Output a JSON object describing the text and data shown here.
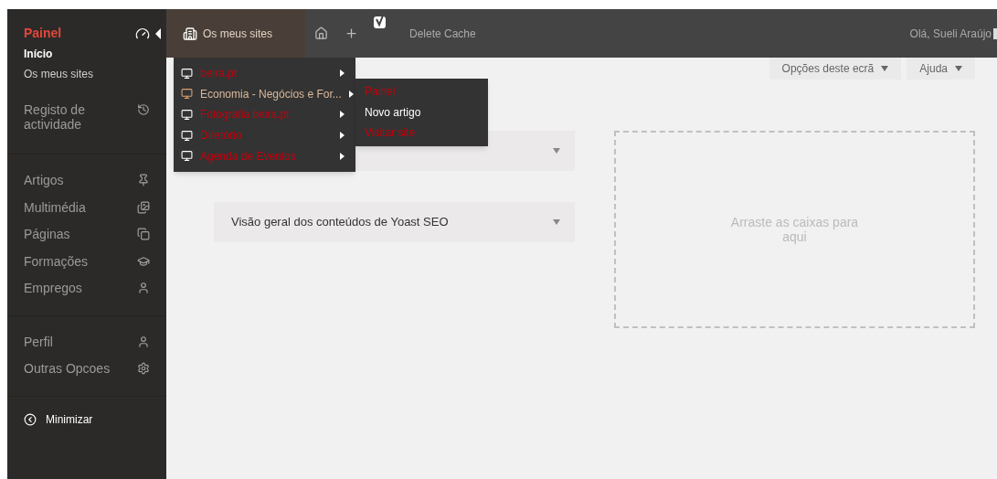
{
  "sidebar": {
    "heading": "Painel",
    "sub_items": [
      {
        "label": "Início",
        "selected": true
      },
      {
        "label": "Os meus sites",
        "selected": false
      }
    ],
    "groups": [
      [
        {
          "label": "Registo de actividade"
        }
      ],
      [
        {
          "label": "Artigos"
        },
        {
          "label": "Multimédia"
        },
        {
          "label": "Páginas"
        },
        {
          "label": "Formações"
        },
        {
          "label": "Empregos"
        }
      ],
      [
        {
          "label": "Perfil"
        },
        {
          "label": "Outras Opcoes"
        }
      ]
    ],
    "minimize": "Minimizar"
  },
  "top_bar": {
    "my_sites": "Os meus sites",
    "delete_cache": "Delete Cache",
    "greeting": "Olá, Sueli Araújo"
  },
  "sites_menu": [
    {
      "label": "beira.pt",
      "selected": false
    },
    {
      "label": "Economia - Negócios e For...",
      "selected": true
    },
    {
      "label": "Fotografia beira.pt",
      "selected": false
    },
    {
      "label": "Diretório",
      "selected": false
    },
    {
      "label": "Agenda de Eventos",
      "selected": false
    }
  ],
  "site_submenu": [
    {
      "label": "Painel",
      "selected": false
    },
    {
      "label": "Novo artigo",
      "selected": true
    },
    {
      "label": "Visitar site",
      "selected": false
    }
  ],
  "screen_buttons": [
    "Opções deste ecrã",
    "Ajuda"
  ],
  "panels": [
    {
      "kind": "covered"
    },
    {
      "kind": "titled",
      "title": "Visão geral dos conteúdos de Yoast SEO"
    }
  ],
  "drop_zone": "Arraste as caixas para aqui"
}
